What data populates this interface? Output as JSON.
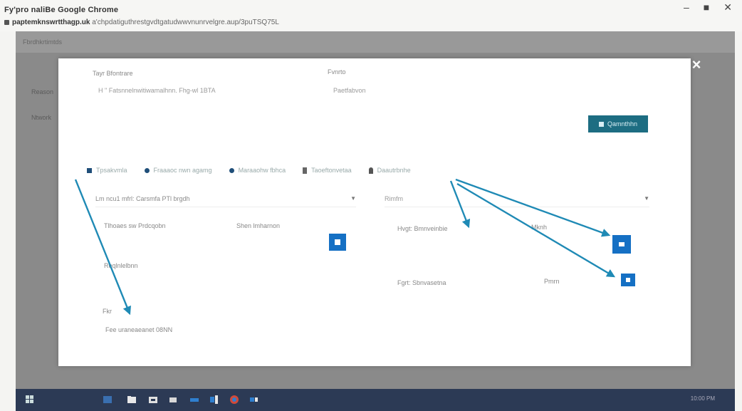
{
  "window": {
    "title": "Fy'pro naliBe Google Chrome",
    "url_host": "paptemknswrtthagp.uk",
    "url_path": "a'chpdatiguthrestgvdtgatudwwvnunrvelgre.aup/3puTSQ75L"
  },
  "window_controls": {
    "minimize": "–",
    "restore": "■",
    "close": "✕"
  },
  "background_page": {
    "header": "Fbrdhkrtimtds",
    "side_item_1": "Reason",
    "side_item_2": "Ntwork"
  },
  "modal": {
    "close_glyph": "×",
    "field_1_label": "Tayr Bfontrare",
    "field_1_value": "H \" Fatsnnelnwitiwamalhnn. Fhg-wl 1BTA",
    "field_2_label": "Fvnrto",
    "field_2_value": "Paetfabvon",
    "submit_label": "Qamnthhn",
    "tabs": [
      {
        "icon": "square",
        "label": "Tpsakvmla"
      },
      {
        "icon": "circle",
        "label": "Fraaaoc nwn agamg"
      },
      {
        "icon": "circle",
        "label": "Maraaohw fbhca"
      },
      {
        "icon": "info",
        "label": "Taoeftonvetaa"
      },
      {
        "icon": "person",
        "label": "Daautrbnhe"
      }
    ],
    "select_1_value": "Lm ncu1 mfrl: Carsmfa PTl brgdh",
    "select_2_value": "Rimfm",
    "left_row_label": "Tlhoaes sw Prdcqobn",
    "left_row_value": "Shen lmharnon",
    "left_item_2": "Reqlnlelbnn",
    "left_small_label": "Fkr",
    "left_bottom_value": "Fee uraneaeanet 08NN",
    "right_row_1_label": "Hvgt: Bmnveinbie",
    "right_row_1_value": "Mknh",
    "right_row_2_label": "Fgrt: Sbnvasetna",
    "right_row_2_value": "Pmrn"
  },
  "arrow_color": "#1f8ab5",
  "taskbar": {
    "clock": "10:00 PM"
  }
}
